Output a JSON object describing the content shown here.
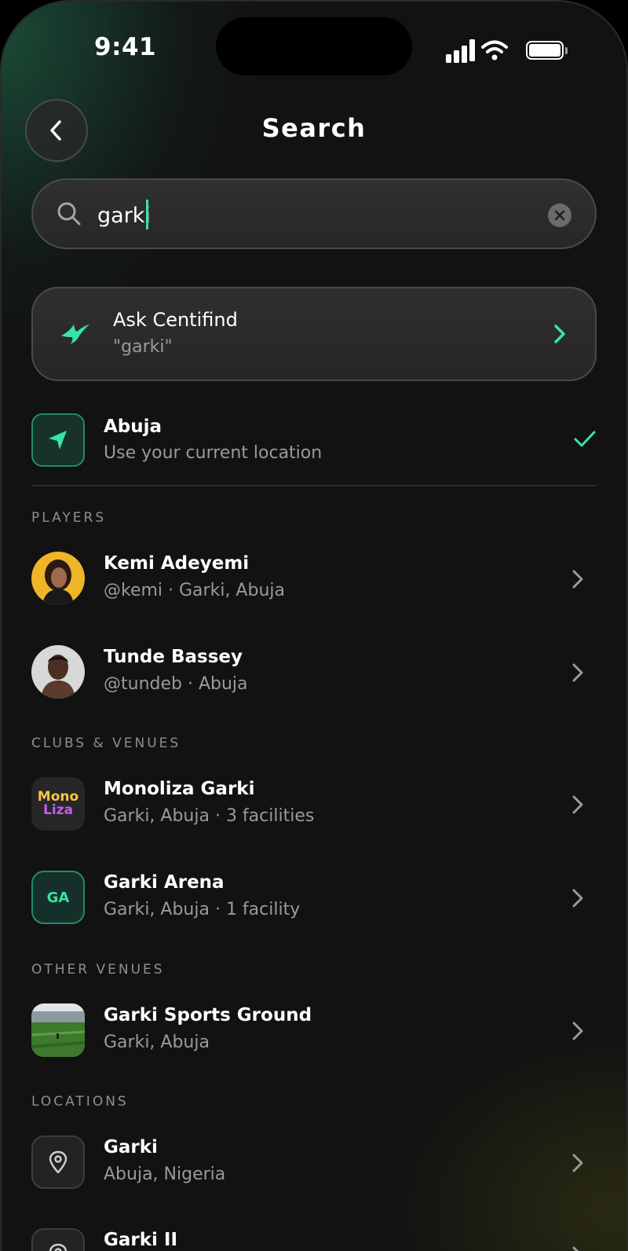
{
  "status_bar": {
    "time": "9:41",
    "signal_icon": "signal-bars-icon",
    "wifi_icon": "wifi-icon",
    "battery_icon": "battery-icon"
  },
  "header": {
    "title": "Search",
    "back_icon": "chevron-left-icon"
  },
  "search": {
    "value": "garki",
    "search_icon": "search-icon",
    "clear_icon": "clear-x-icon"
  },
  "ask": {
    "title": "Ask Centifind",
    "query": "\"garki\"",
    "accent": "#35e6a4"
  },
  "current_location": {
    "title": "Abuja",
    "subtitle": "Use your current location",
    "selected": true
  },
  "sections": {
    "players": {
      "label": "PLAYERS",
      "items": [
        {
          "name": "Kemi Adeyemi",
          "meta": "@kemi · Garki, Abuja",
          "avatar": "avatar-woman-yellow-bg"
        },
        {
          "name": "Tunde Bassey",
          "meta": "@tundeb · Abuja",
          "avatar": "avatar-man-light-bg"
        }
      ]
    },
    "clubs": {
      "label": "CLUBS & VENUES",
      "items": [
        {
          "name": "Monoliza Garki",
          "meta": "Garki, Abuja · 3 facilities",
          "logo_text_top": "Mono",
          "logo_text_bottom": "Liza"
        },
        {
          "name": "Garki Arena",
          "meta": "Garki, Abuja · 1 facility",
          "initials": "GA"
        }
      ]
    },
    "other_venues": {
      "label": "OTHER VENUES",
      "items": [
        {
          "name": "Garki Sports Ground",
          "meta": "Garki, Abuja",
          "thumb": "sports-field-photo"
        }
      ]
    },
    "locations": {
      "label": "LOCATIONS",
      "items": [
        {
          "name": "Garki",
          "meta": "Abuja, Nigeria",
          "icon": "map-pin-icon"
        },
        {
          "name": "Garki II",
          "meta": "",
          "icon": "map-pin-icon"
        }
      ]
    }
  },
  "colors": {
    "accent": "#35e6a4",
    "background": "#121212",
    "muted_text": "#9a9a9a"
  }
}
